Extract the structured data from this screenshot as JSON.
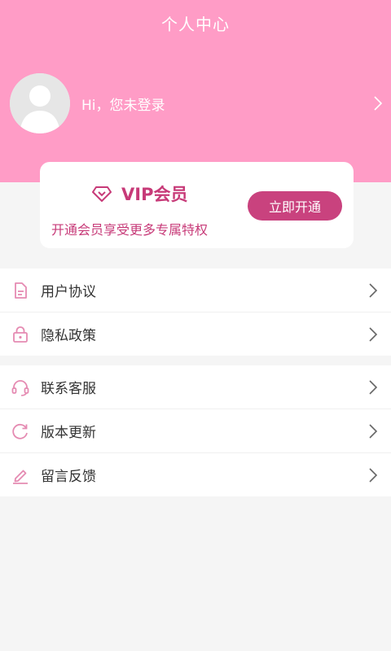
{
  "header": {
    "title": "个人中心",
    "login_prompt": "Hi，您未登录"
  },
  "vip": {
    "title": "VIP会员",
    "subtitle": "开通会员享受更多专属特权",
    "button_label": "立即开通"
  },
  "menu_group_1": {
    "items": [
      {
        "label": "用户协议",
        "icon": "document-icon"
      },
      {
        "label": "隐私政策",
        "icon": "lock-icon"
      }
    ]
  },
  "menu_group_2": {
    "items": [
      {
        "label": "联系客服",
        "icon": "headset-icon"
      },
      {
        "label": "版本更新",
        "icon": "refresh-icon"
      },
      {
        "label": "留言反馈",
        "icon": "pencil-icon"
      }
    ]
  },
  "colors": {
    "header_pink": "#ff9cc6",
    "accent": "#c73a78",
    "icon_pink": "#e58bb2"
  }
}
